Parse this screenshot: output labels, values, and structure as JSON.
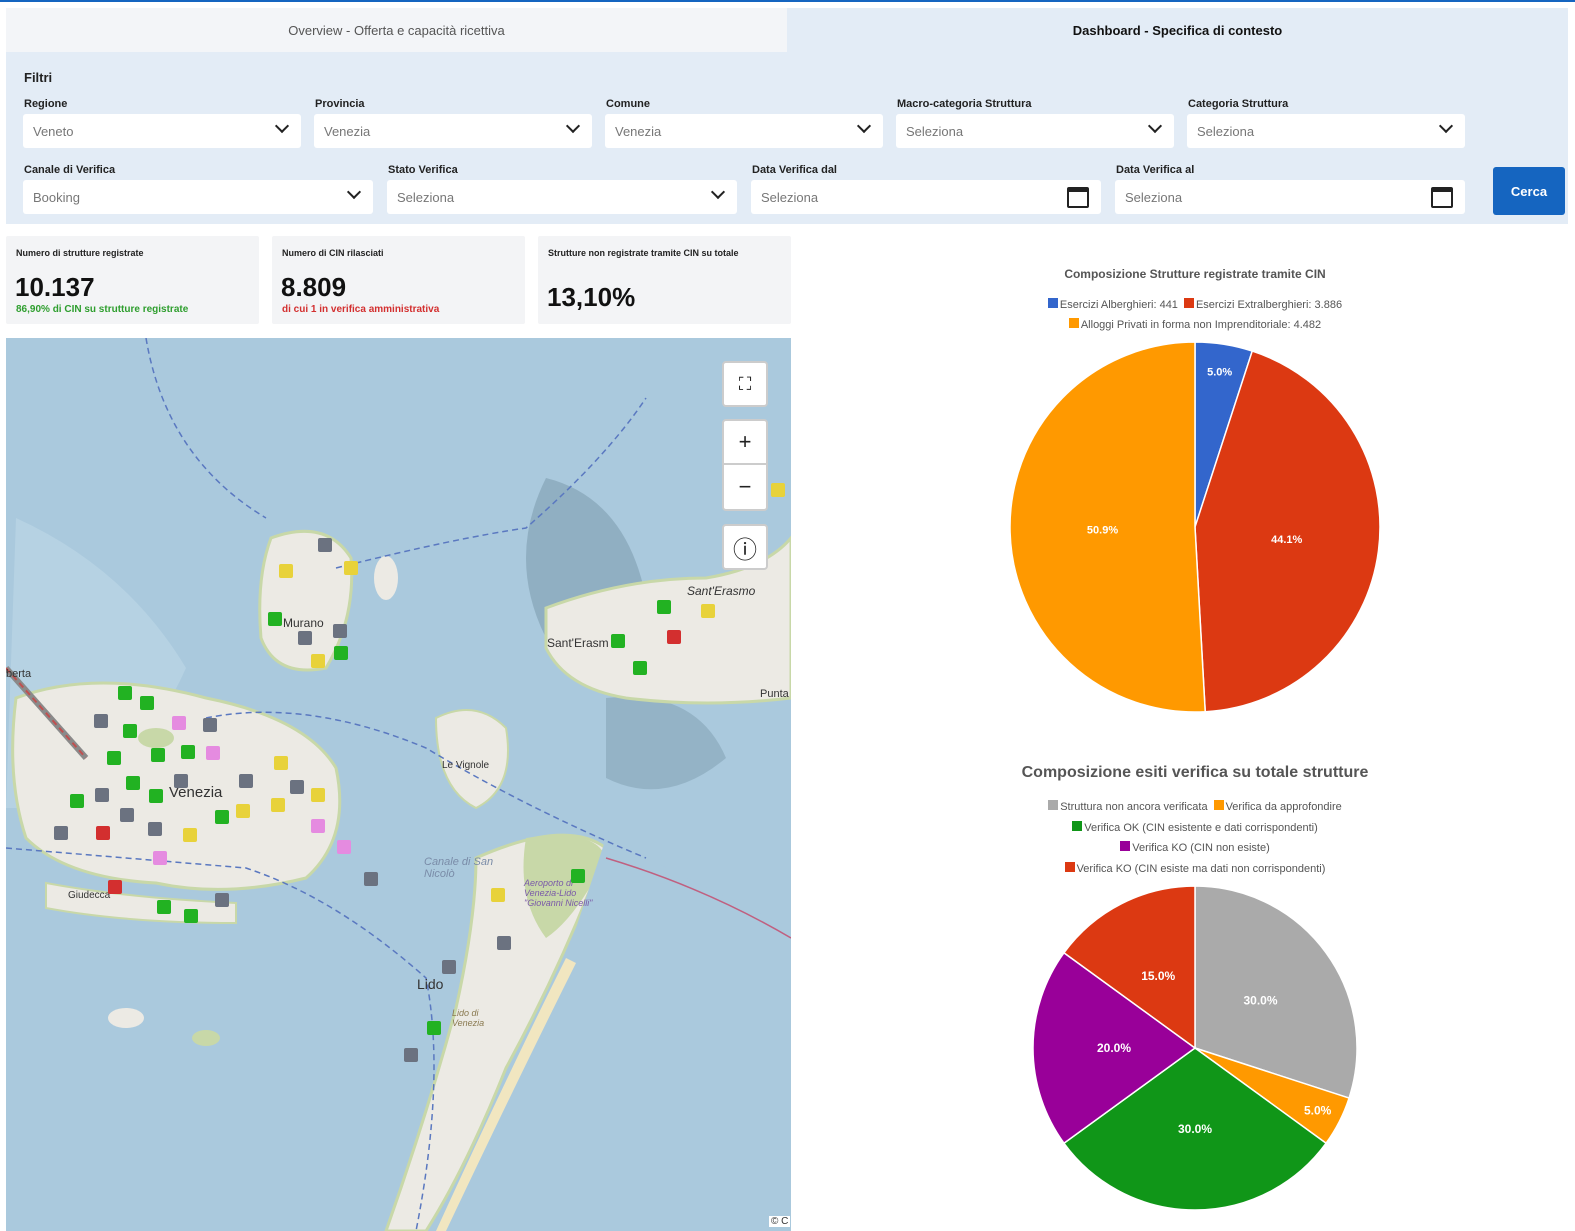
{
  "tabs": [
    {
      "label": "Overview - Offerta e capacità ricettiva",
      "active": false
    },
    {
      "label": "Dashboard - Specifica di contesto",
      "active": true
    }
  ],
  "filters": {
    "title": "Filtri",
    "regione": {
      "label": "Regione",
      "value": "Veneto"
    },
    "provincia": {
      "label": "Provincia",
      "value": "Venezia"
    },
    "comune": {
      "label": "Comune",
      "value": "Venezia"
    },
    "macro_categoria": {
      "label": "Macro-categoria Struttura",
      "value": "Seleziona"
    },
    "categoria": {
      "label": "Categoria Struttura",
      "value": "Seleziona"
    },
    "canale": {
      "label": "Canale di Verifica",
      "value": "Booking"
    },
    "stato": {
      "label": "Stato Verifica",
      "value": "Seleziona"
    },
    "data_dal": {
      "label": "Data Verifica dal",
      "value": "Seleziona"
    },
    "data_al": {
      "label": "Data Verifica al",
      "value": "Seleziona"
    },
    "search_label": "Cerca"
  },
  "kpis": [
    {
      "label": "Numero di strutture registrate",
      "value": "10.137",
      "sub": "86,90% di CIN su strutture registrate",
      "sub_color": "#2e9e2e"
    },
    {
      "label": "Numero di CIN rilasciati",
      "value": "8.809",
      "sub": "di cui 1 in verifica amministrativa",
      "sub_color": "#d32f2f"
    },
    {
      "label": "Strutture non registrate tramite CIN su totale",
      "value": "13,10%",
      "sub": ""
    }
  ],
  "map": {
    "place_labels": [
      "Murano",
      "Sant'Erasmo",
      "Sant'Erasm",
      "Venezia",
      "Le Vignole",
      "Lido",
      "Giudecca",
      "Punta",
      "berta",
      "Canale di San Nicolò",
      "Aeroporto di Venezia-Lido \"Giovanni Nicelli\"",
      "Lido di Venezia"
    ],
    "controls": {
      "fullscreen": "⛶",
      "zoom_in": "+",
      "zoom_out": "−",
      "info": "ⓘ"
    },
    "attribution": "© C",
    "marker_colors": {
      "grey": "#6b7280",
      "green": "#22b222",
      "yellow": "#e8d23a",
      "pink": "#e58be0",
      "red": "#d32f2f"
    }
  },
  "chart_data": [
    {
      "type": "pie",
      "title": "Composizione Strutture registrate tramite CIN",
      "legend": [
        "Esercizi Alberghieri: 441",
        "Esercizi Extralberghieri: 3.886",
        "Alloggi Privati in forma non Imprenditoriale: 4.482"
      ],
      "series": [
        {
          "name": "Esercizi Alberghieri",
          "value": 441,
          "label": "5.0%",
          "color": "#3366cc"
        },
        {
          "name": "Esercizi Extralberghieri",
          "value": 3886,
          "label": "44.1%",
          "color": "#dc3912"
        },
        {
          "name": "Alloggi Privati in forma non Imprenditoriale",
          "value": 4482,
          "label": "50.9%",
          "color": "#ff9900"
        }
      ]
    },
    {
      "type": "pie",
      "title": "Composizione esiti verifica su totale strutture",
      "legend": [
        "Struttura non ancora verificata",
        "Verifica da approfondire",
        "Verifica OK (CIN esistente e dati corrispondenti)",
        "Verifica KO (CIN non esiste)",
        "Verifica KO (CIN esiste ma dati non corrispondenti)"
      ],
      "series": [
        {
          "name": "Struttura non ancora verificata",
          "value": 30,
          "label": "30.0%",
          "color": "#aaaaaa"
        },
        {
          "name": "Verifica da approfondire",
          "value": 5,
          "label": "5.0%",
          "color": "#ff9900"
        },
        {
          "name": "Verifica OK (CIN esistente e dati corrispondenti)",
          "value": 30,
          "label": "30.0%",
          "color": "#109618"
        },
        {
          "name": "Verifica KO (CIN non esiste)",
          "value": 20,
          "label": "20.0%",
          "color": "#990099"
        },
        {
          "name": "Verifica KO (CIN esiste ma dati non corrispondenti)",
          "value": 15,
          "label": "15.0%",
          "color": "#dc3912"
        }
      ]
    }
  ]
}
